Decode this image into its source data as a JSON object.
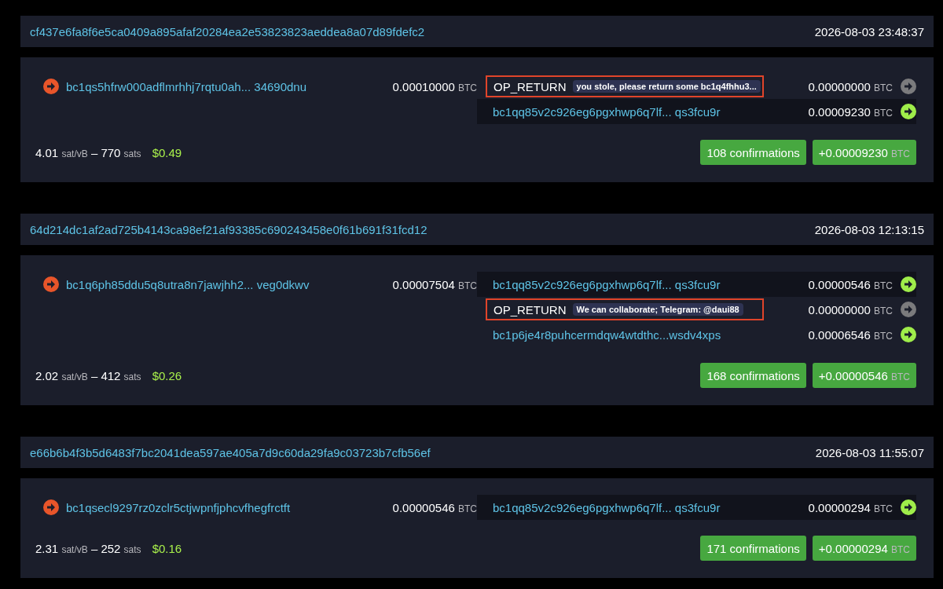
{
  "transactions": [
    {
      "txid": "cf437e6fa8f6e5ca0409a895afaf20284ea2e53823823aeddea8a07d89fdefc2",
      "time": "2026-08-03 23:48:37",
      "inputs": [
        {
          "address": "bc1qs5hfrw000adflmrhhj7rqtu0ah... 34690dnu",
          "amount": "0.00010000",
          "unit": "BTC"
        }
      ],
      "outputs": [
        {
          "kind": "op_return",
          "label": "OP_RETURN",
          "message": "you stole, please return some bc1q4fhhu3...",
          "amount": "0.00000000",
          "unit": "BTC",
          "highlighted": false,
          "outlined": true
        },
        {
          "kind": "address",
          "address": "bc1qq85v2c926eg6pgxhwp6q7lf... qs3fcu9r",
          "amount": "0.00009230",
          "unit": "BTC",
          "highlighted": true
        }
      ],
      "fee": {
        "rate": "4.01",
        "rate_unit": "sat/vB",
        "dash": "–",
        "sats": "770",
        "sats_unit": "sats",
        "fiat": "$0.49"
      },
      "confirmations": "108 confirmations",
      "total": "+0.00009230",
      "total_unit": "BTC"
    },
    {
      "txid": "64d214dc1af2ad725b4143ca98ef21af93385c690243458e0f61b691f31fcd12",
      "time": "2026-08-03 12:13:15",
      "inputs": [
        {
          "address": "bc1q6ph85ddu5q8utra8n7jawjhh2... veg0dkwv",
          "amount": "0.00007504",
          "unit": "BTC"
        }
      ],
      "outputs": [
        {
          "kind": "address",
          "address": "bc1qq85v2c926eg6pgxhwp6q7lf... qs3fcu9r",
          "amount": "0.00000546",
          "unit": "BTC",
          "highlighted": true
        },
        {
          "kind": "op_return",
          "label": "OP_RETURN",
          "message": "We can collaborate; Telegram: @daui88",
          "amount": "0.00000000",
          "unit": "BTC",
          "highlighted": false,
          "outlined": true
        },
        {
          "kind": "address",
          "address": "bc1p6je4r8puhcermdqw4wtdthc...wsdv4xps",
          "amount": "0.00006546",
          "unit": "BTC",
          "highlighted": false
        }
      ],
      "fee": {
        "rate": "2.02",
        "rate_unit": "sat/vB",
        "dash": "–",
        "sats": "412",
        "sats_unit": "sats",
        "fiat": "$0.26"
      },
      "confirmations": "168 confirmations",
      "total": "+0.00000546",
      "total_unit": "BTC"
    },
    {
      "txid": "e66b6b4f3b5d6483f7bc2041dea597ae405a7d9c60da29fa9c03723b7cfb56ef",
      "time": "2026-08-03 11:55:07",
      "inputs": [
        {
          "address": "bc1qsecl9297rz0zclr5ctjwpnfjphcvfhegfrctft",
          "amount": "0.00000546",
          "unit": "BTC"
        }
      ],
      "outputs": [
        {
          "kind": "address",
          "address": "bc1qq85v2c926eg6pgxhwp6q7lf... qs3fcu9r",
          "amount": "0.00000294",
          "unit": "BTC",
          "highlighted": true
        }
      ],
      "fee": {
        "rate": "2.31",
        "rate_unit": "sat/vB",
        "dash": "–",
        "sats": "252",
        "sats_unit": "sats",
        "fiat": "$0.16"
      },
      "confirmations": "171 confirmations",
      "total": "+0.00000294",
      "total_unit": "BTC"
    }
  ]
}
